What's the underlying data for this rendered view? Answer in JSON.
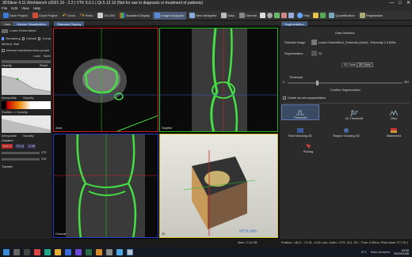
{
  "app": {
    "title": "3DSlicer 4.11 Workbench x2021.10 - 2.2 | VTK 9.0.1 | Qt 5.12.10 (Not for use in diagnosis or treatment of patients)",
    "window_controls": [
      "—",
      "□",
      "✕"
    ]
  },
  "menu": [
    "File",
    "Edit",
    "View",
    "Help"
  ],
  "toolbar": {
    "save_project": "Save Project",
    "close_project": "Close Project",
    "undo": "Undo",
    "redo": "Redo",
    "dicom": "DICOM",
    "standard_display": "Standard Display",
    "image_navigator": "Image Navigator",
    "view_navigator": "View Navigator",
    "data": "Data",
    "general": "General",
    "help": "Help",
    "quantification": "Quantification",
    "registration": "Registration"
  },
  "tabs": {
    "left": [
      "Data",
      "Volume Visualization"
    ],
    "center": "Standard Display",
    "right": "Segmentation"
  },
  "left_panel": {
    "selected_volume": "Lower Extremities1",
    "options": [
      "Rendering",
      "Default",
      "Comp"
    ],
    "method": "Method",
    "method_value": "Ball",
    "tf_label": "Internal transferfunction preset",
    "load_label": "Load",
    "save_label": "Save",
    "reset_label": "Reset",
    "opacity_label": "Opacity",
    "interpolate_label": "Interpolate",
    "scalar_opacity_label": "Scalars -> Opacity",
    "gradient_label": "Gradient",
    "values": [
      "408.01",
      "79.10",
      "-0.98"
    ],
    "spin_values": [
      "270",
      "314"
    ],
    "bottom_label": "Transfer"
  },
  "right_panel": {
    "header": "Data Selection",
    "selected_image_label": "Selected Image",
    "selected_image_value": "Lower Extremities1_Extremity (Adult) - Extremity 1.0 B60s",
    "segmentation_label": "Segmentation",
    "segmentation_value": "S1",
    "tools_2d": "2D Tools",
    "tools_3d": "3D Tools",
    "threshold_label": "Threshold",
    "threshold_min": "0",
    "threshold_max": "287",
    "confirm_label": "Confirm Segmentation",
    "create_label": "Create as new segmentation",
    "tools": [
      "Threshold",
      "UL Threshold",
      "Otsu",
      "Fast Marching 3D",
      "Region Growing 3D",
      "Watershed",
      "Picking"
    ]
  },
  "views": {
    "axial_label": "Axial",
    "sagittal_label": "Sagittal",
    "coronal_label": "Coronal",
    "threed_label": "3D",
    "watermark": "MITK.diffu",
    "scale_values": [
      "150",
      "100",
      "50"
    ]
  },
  "status": {
    "text": "Position: <80.0, -74.78, -4.00> mm; Index: <275, 314, 75> ; Time: 0.00ms; Pixel value: 277.00 (Lower Extremities1_Extremity (Adult))",
    "memory": "Mem: 2.24 GB"
  },
  "taskbar": {
    "temp": "8°C",
    "weather": "Rain showers",
    "time": "16:05",
    "date": "2022/01/05"
  },
  "colors": {
    "accent": "#3d5b8a",
    "segmentation_green": "#44e044",
    "axial_border": "#d02020",
    "sagittal_border": "#20c020",
    "coronal_border": "#2040d0",
    "threed_border": "#d0c020"
  }
}
